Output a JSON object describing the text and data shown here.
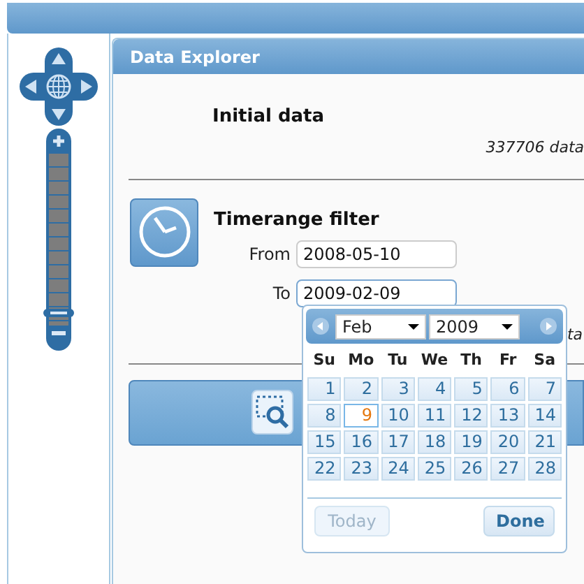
{
  "panel": {
    "title": "Data Explorer"
  },
  "initial_data": {
    "heading": "Initial data",
    "count": "337706 data"
  },
  "timerange": {
    "heading": "Timerange filter",
    "from_label": "From",
    "from_value": "2008-05-10",
    "to_label": "To",
    "to_value": "2009-02-09",
    "note_fragment": "ta"
  },
  "datepicker": {
    "month": "Feb",
    "year": "2009",
    "weekdays": [
      "Su",
      "Mo",
      "Tu",
      "We",
      "Th",
      "Fr",
      "Sa"
    ],
    "days": [
      {
        "label": "1",
        "selected": false
      },
      {
        "label": "2",
        "selected": false
      },
      {
        "label": "3",
        "selected": false
      },
      {
        "label": "4",
        "selected": false
      },
      {
        "label": "5",
        "selected": false
      },
      {
        "label": "6",
        "selected": false
      },
      {
        "label": "7",
        "selected": false
      },
      {
        "label": "8",
        "selected": false
      },
      {
        "label": "9",
        "selected": true
      },
      {
        "label": "10",
        "selected": false
      },
      {
        "label": "11",
        "selected": false
      },
      {
        "label": "12",
        "selected": false
      },
      {
        "label": "13",
        "selected": false
      },
      {
        "label": "14",
        "selected": false
      },
      {
        "label": "15",
        "selected": false
      },
      {
        "label": "16",
        "selected": false
      },
      {
        "label": "17",
        "selected": false
      },
      {
        "label": "18",
        "selected": false
      },
      {
        "label": "19",
        "selected": false
      },
      {
        "label": "20",
        "selected": false
      },
      {
        "label": "21",
        "selected": false
      },
      {
        "label": "22",
        "selected": false
      },
      {
        "label": "23",
        "selected": false
      },
      {
        "label": "24",
        "selected": false
      },
      {
        "label": "25",
        "selected": false
      },
      {
        "label": "26",
        "selected": false
      },
      {
        "label": "27",
        "selected": false
      },
      {
        "label": "28",
        "selected": false
      }
    ],
    "buttons": [
      {
        "label": "Today",
        "disabled": true
      },
      {
        "label": "Done",
        "disabled": false
      }
    ]
  }
}
